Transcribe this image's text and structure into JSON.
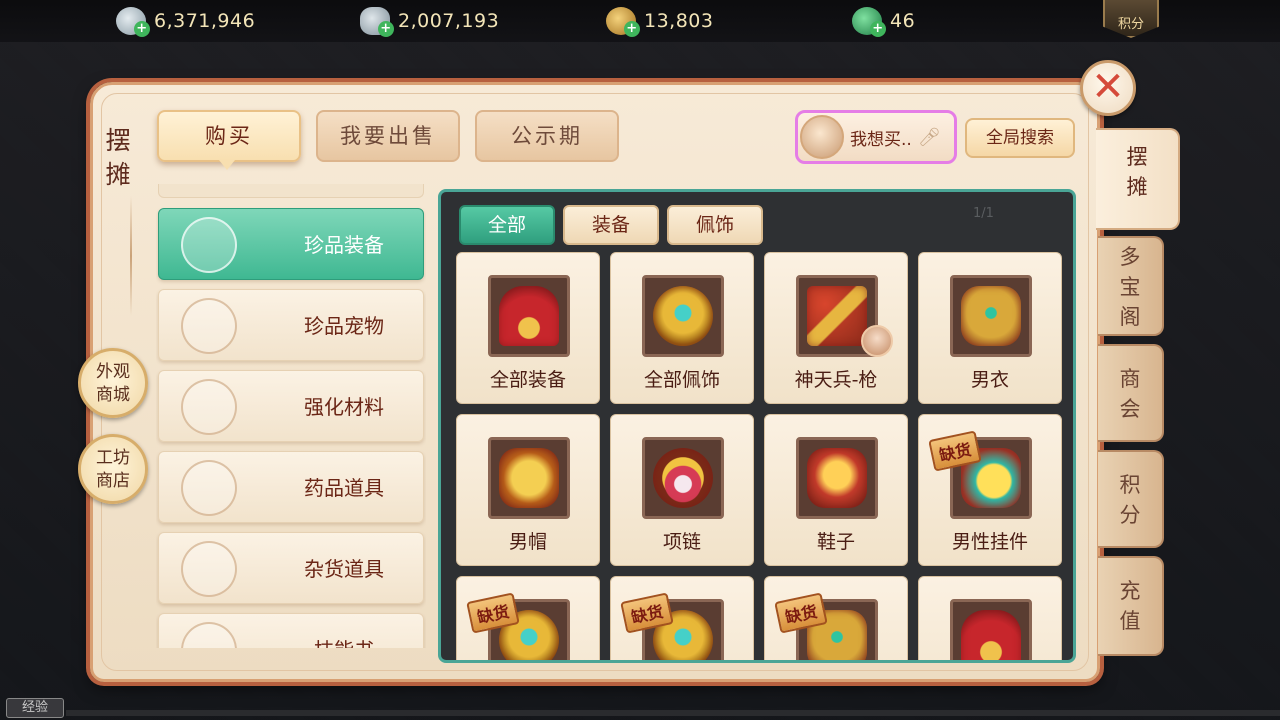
{
  "currencies": [
    {
      "icon": "silver-coin-icon",
      "value": "6,371,946"
    },
    {
      "icon": "silver-ingot-icon",
      "value": "2,007,193"
    },
    {
      "icon": "copper-coin-icon",
      "value": "13,803"
    },
    {
      "icon": "jade-icon",
      "value": "46"
    }
  ],
  "top_points_label": "积分",
  "panel": {
    "title": "摆摊",
    "tabs": [
      "购买",
      "我要出售",
      "公示期"
    ],
    "want_buy_label": "我想买..",
    "global_search_label": "全局搜索",
    "close_symbol": "✕"
  },
  "side_buttons": [
    {
      "line1": "外观",
      "line2": "商城"
    },
    {
      "line1": "工坊",
      "line2": "商店"
    }
  ],
  "right_tabs": [
    {
      "chars": [
        "摆",
        "摊"
      ],
      "active": true
    },
    {
      "chars": [
        "多",
        "宝",
        "阁"
      ],
      "active": false
    },
    {
      "chars": [
        "商",
        "会"
      ],
      "active": false
    },
    {
      "chars": [
        "积",
        "分"
      ],
      "active": false
    },
    {
      "chars": [
        "充",
        "值"
      ],
      "active": false
    }
  ],
  "categories": [
    {
      "label": "珍品装备",
      "icon": "rare-equipment-icon",
      "active": true
    },
    {
      "label": "珍品宠物",
      "icon": "pet-cat-icon",
      "active": false
    },
    {
      "label": "强化材料",
      "icon": "ore-material-icon",
      "active": false
    },
    {
      "label": "药品道具",
      "icon": "potion-icon",
      "active": false
    },
    {
      "label": "杂货道具",
      "icon": "sundries-icon",
      "active": false
    },
    {
      "label": "技能书",
      "icon": "skill-book-icon",
      "active": false
    }
  ],
  "subtabs": [
    "全部",
    "装备",
    "佩饰"
  ],
  "subtab_active": 0,
  "pager": "1/1",
  "out_of_stock_label": "缺货",
  "items": [
    {
      "label": "全部装备",
      "art": "fan",
      "out_of_stock": false
    },
    {
      "label": "全部佩饰",
      "art": "ring",
      "out_of_stock": false
    },
    {
      "label": "神天兵-枪",
      "art": "spear",
      "out_of_stock": false,
      "badge": true
    },
    {
      "label": "男衣",
      "art": "armor",
      "out_of_stock": false
    },
    {
      "label": "男帽",
      "art": "helm",
      "out_of_stock": false
    },
    {
      "label": "项链",
      "art": "neck",
      "out_of_stock": false
    },
    {
      "label": "鞋子",
      "art": "shoe",
      "out_of_stock": false
    },
    {
      "label": "男性挂件",
      "art": "pend",
      "out_of_stock": true
    },
    {
      "label": "",
      "art": "ring",
      "out_of_stock": true
    },
    {
      "label": "",
      "art": "ring",
      "out_of_stock": true
    },
    {
      "label": "",
      "art": "armor",
      "out_of_stock": true
    },
    {
      "label": "",
      "art": "fan",
      "out_of_stock": false
    }
  ],
  "exp_label": "经验"
}
